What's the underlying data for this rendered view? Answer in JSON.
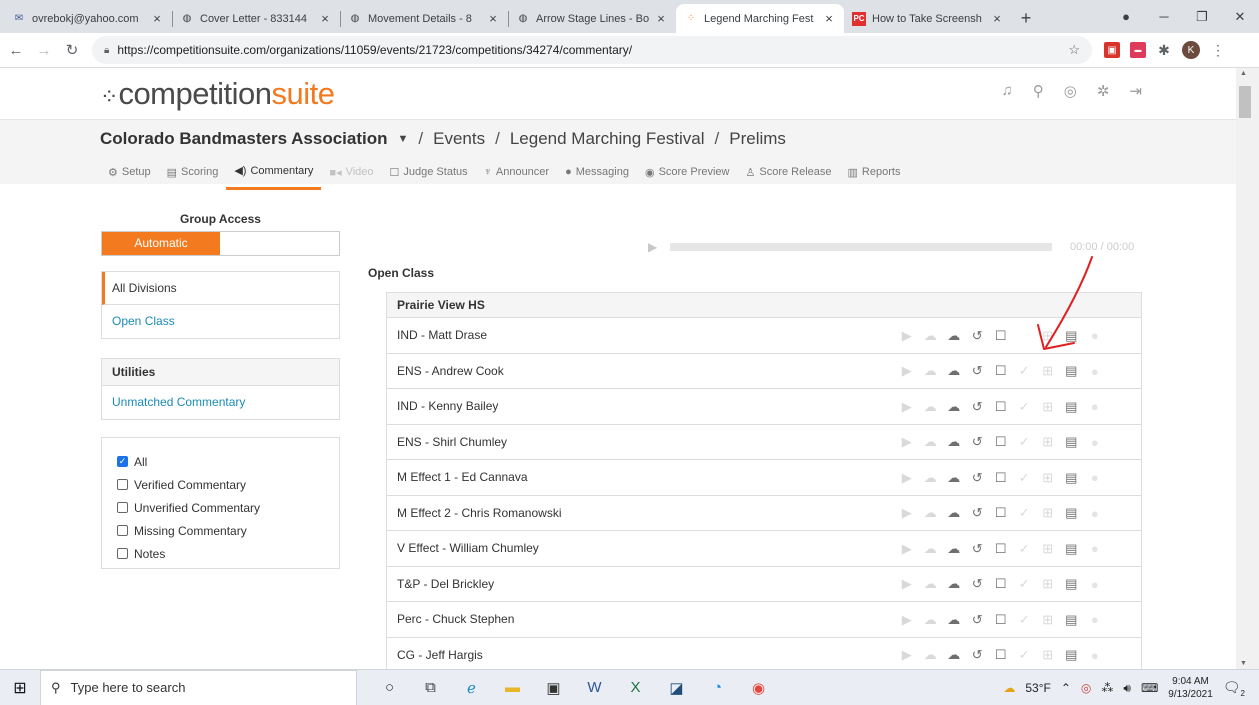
{
  "browser": {
    "tabs": [
      {
        "title": "ovrebokj@yahoo.com",
        "icon": "mail-icon"
      },
      {
        "title": "Cover Letter - 833144",
        "icon": "globe-icon"
      },
      {
        "title": "Movement Details - 8",
        "icon": "globe-icon"
      },
      {
        "title": "Arrow Stage Lines - Bo",
        "icon": "globe-icon"
      },
      {
        "title": "Legend Marching Fest",
        "icon": "competitionsuite-icon",
        "active": true
      },
      {
        "title": "How to Take Screensh",
        "icon": "pc-icon"
      }
    ],
    "url": "https://competitionsuite.com/organizations/11059/events/21723/competitions/34274/commentary/",
    "profile_initial": "K"
  },
  "site": {
    "logo_main": "competition",
    "logo_accent": "suite"
  },
  "breadcrumb": {
    "org": "Colorado Bandmasters Association",
    "events": "Events",
    "festival": "Legend Marching Festival",
    "round": "Prelims"
  },
  "subnav": {
    "setup": "Setup",
    "scoring": "Scoring",
    "commentary": "Commentary",
    "video": "Video",
    "judge_status": "Judge Status",
    "announcer": "Announcer",
    "messaging": "Messaging",
    "score_preview": "Score Preview",
    "score_release": "Score Release",
    "reports": "Reports"
  },
  "sidebar": {
    "group_access_title": "Group Access",
    "automatic": "Automatic",
    "divisions": [
      "All Divisions",
      "Open Class"
    ],
    "utilities_title": "Utilities",
    "unmatched": "Unmatched Commentary",
    "filters": [
      {
        "label": "All",
        "checked": true
      },
      {
        "label": "Verified Commentary",
        "checked": false
      },
      {
        "label": "Unverified Commentary",
        "checked": false
      },
      {
        "label": "Missing Commentary",
        "checked": false
      },
      {
        "label": "Notes",
        "checked": false
      }
    ]
  },
  "player": {
    "time": "00:00 / 00:00"
  },
  "main": {
    "class_title": "Open Class",
    "group_name": "Prairie View HS",
    "judges": [
      "IND - Matt Drase",
      "ENS - Andrew Cook",
      "IND - Kenny Bailey",
      "ENS - Shirl Chumley",
      "M Effect 1 - Ed Cannava",
      "M Effect 2 - Chris Romanowski",
      "V Effect - William Chumley",
      "T&P - Del Brickley",
      "Perc - Chuck Stephen",
      "CG - Jeff Hargis"
    ]
  },
  "taskbar": {
    "search_placeholder": "Type here to search",
    "weather": "53°F",
    "time": "9:04 AM",
    "date": "9/13/2021",
    "notification_count": "2"
  },
  "colors": {
    "accent": "#f47a20",
    "link": "#1a8bb5",
    "annotation": "#e02020"
  }
}
